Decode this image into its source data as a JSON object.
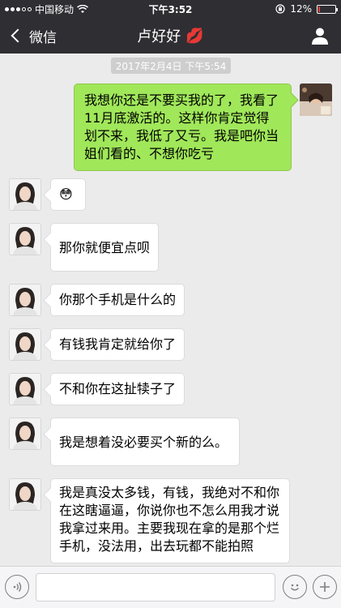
{
  "status_bar": {
    "carrier": "中国移动",
    "time": "下午3:52",
    "battery": "12%",
    "battery_level": 0.12,
    "signal_strength": 3,
    "signal_max": 5,
    "colors": {
      "battery_low": "#e5473f"
    }
  },
  "nav": {
    "back_label": "微信",
    "title": "卢好好",
    "title_emoji": "💋",
    "icons": {
      "back": "chevron-left-icon",
      "profile": "person-icon"
    }
  },
  "chat": {
    "timestamp": "2017年2月4日 下午5:54",
    "messages": [
      {
        "from": "me",
        "text": "我想你还是不要买我的了，我看了11月底激活的。这样你肯定觉得划不来，我低了又亏。我是吧你当姐们看的、不想你吃亏"
      },
      {
        "from": "friend",
        "text": "😳"
      },
      {
        "from": "friend",
        "text": "那你就便宜点呗"
      },
      {
        "from": "friend",
        "text": "你那个手机是什么的"
      },
      {
        "from": "friend",
        "text": "有钱我肯定就给你了"
      },
      {
        "from": "friend",
        "text": "不和你在这扯犊子了"
      },
      {
        "from": "friend",
        "text": "我是想着没必要买个新的么。"
      },
      {
        "from": "friend",
        "text": "我是真没太多钱，有钱，我绝对不和你在这瞎逼逼，你说你也不怎么用我才说我拿过来用。主要我现在拿的是那个烂手机，没法用，出去玩都不能拍照"
      }
    ],
    "colors": {
      "outgoing_bubble": "#a0e75a",
      "incoming_bubble": "#ffffff",
      "background": "#ebebeb"
    }
  },
  "input_bar": {
    "value": "",
    "icons": {
      "voice": "voice-icon",
      "emoji": "emoji-icon",
      "more": "plus-icon"
    }
  }
}
